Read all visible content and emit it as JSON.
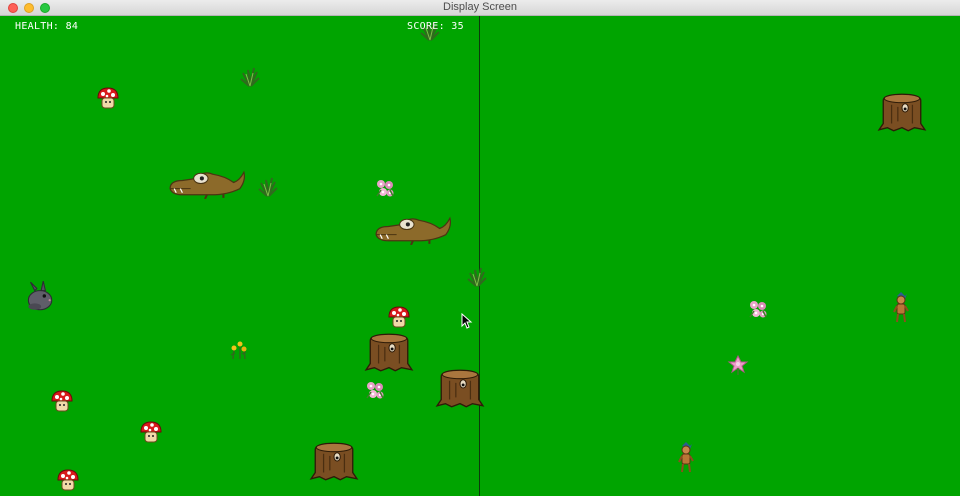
{
  "window": {
    "title": "Display Screen"
  },
  "hud": {
    "health_label": "HEALTH: 84",
    "score_label": "SCORE: 35"
  },
  "colors": {
    "grass": "#00a400",
    "divider": "#0c3a0c",
    "hud_text": "#ffffff"
  },
  "scene": {
    "left_view": [
      "mushroom",
      "mushroom",
      "mushroom",
      "mushroom",
      "mushroom",
      "grass-tuft",
      "grass-tuft",
      "grass-tuft",
      "grass-tuft",
      "crocodile",
      "crocodile",
      "pink-flower",
      "pink-flower",
      "yellow-flowers",
      "gray-bunny",
      "tree-stump",
      "tree-stump",
      "tree-stump"
    ],
    "right_view": [
      "tree-stump",
      "pink-flower",
      "pink-flower",
      "goblin",
      "goblin"
    ]
  }
}
